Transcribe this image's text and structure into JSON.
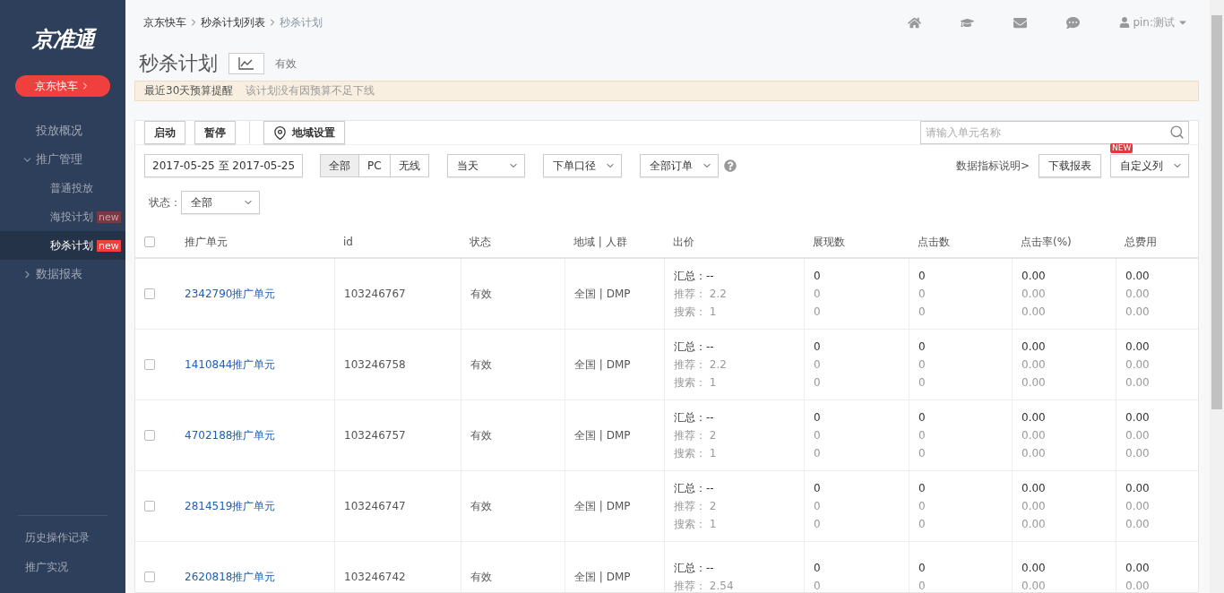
{
  "logo": "京准通",
  "sidebar": {
    "cta": "京东快车",
    "items": [
      {
        "label": "投放概况",
        "kind": "link",
        "selected": false
      },
      {
        "label": "推广管理",
        "kind": "group",
        "expanded": true,
        "selected": false,
        "children": [
          {
            "label": "普通投放",
            "selected": false
          },
          {
            "label": "海投计划",
            "selected": false,
            "badge": "new"
          },
          {
            "label": "秒杀计划",
            "selected": true,
            "badge": "new"
          }
        ]
      },
      {
        "label": "数据报表",
        "kind": "group",
        "expanded": false,
        "selected": false
      }
    ],
    "footer": [
      "历史操作记录",
      "推广实况"
    ]
  },
  "breadcrumb": [
    "京东快车",
    "秒杀计划列表",
    "秒杀计划"
  ],
  "user": "pin:测试",
  "title": "秒杀计划",
  "status": "有效",
  "notice": {
    "title": "最近30天预算提醒",
    "text": "该计划没有因预算不足下线"
  },
  "toolbar": {
    "buttons": [
      "启动",
      "暂停"
    ],
    "region_button": "地域设置",
    "search": {
      "placeholder": "请输入单元名称"
    }
  },
  "filters": {
    "date": "2017-05-25 至 2017-05-25",
    "devices": [
      {
        "label": "全部",
        "selected": true
      },
      {
        "label": "PC",
        "selected": false
      },
      {
        "label": "无线",
        "selected": false
      }
    ],
    "selects": [
      "当天",
      "下单口径",
      "全部订单"
    ],
    "metrics_link": "数据指标说明>",
    "download": "下载报表",
    "columns_select": "自定义列",
    "columns_badge": "NEW",
    "status_label": "状态：",
    "status_select": "全部"
  },
  "table": {
    "header_checked": false,
    "columns": [
      "推广单元",
      "id",
      "状态",
      "地域 | 人群",
      "出价",
      "展现数",
      "点击数",
      "点击率(%)",
      "总费用"
    ],
    "rows": [
      {
        "checked": false,
        "unit": "2342790推广单元",
        "id": "103246767",
        "status": "有效",
        "region": "全国 | DMP",
        "bid": [
          "汇总：--",
          "推荐： 2.2",
          "搜索： 1"
        ],
        "impressions": [
          "0",
          "0",
          "0"
        ],
        "clicks": [
          "0",
          "0",
          "0"
        ],
        "ctr": [
          "0.00",
          "0.00",
          "0.00"
        ],
        "cost": [
          "0.00",
          "0.00",
          "0.00"
        ]
      },
      {
        "checked": false,
        "unit": "1410844推广单元",
        "id": "103246758",
        "status": "有效",
        "region": "全国 | DMP",
        "bid": [
          "汇总：--",
          "推荐： 2.2",
          "搜索： 1"
        ],
        "impressions": [
          "0",
          "0",
          "0"
        ],
        "clicks": [
          "0",
          "0",
          "0"
        ],
        "ctr": [
          "0.00",
          "0.00",
          "0.00"
        ],
        "cost": [
          "0.00",
          "0.00",
          "0.00"
        ]
      },
      {
        "checked": false,
        "unit": "4702188推广单元",
        "id": "103246757",
        "status": "有效",
        "region": "全国 | DMP",
        "bid": [
          "汇总：--",
          "推荐： 2",
          "搜索： 1"
        ],
        "impressions": [
          "0",
          "0",
          "0"
        ],
        "clicks": [
          "0",
          "0",
          "0"
        ],
        "ctr": [
          "0.00",
          "0.00",
          "0.00"
        ],
        "cost": [
          "0.00",
          "0.00",
          "0.00"
        ]
      },
      {
        "checked": false,
        "unit": "2814519推广单元",
        "id": "103246747",
        "status": "有效",
        "region": "全国 | DMP",
        "bid": [
          "汇总：--",
          "推荐： 2",
          "搜索： 1"
        ],
        "impressions": [
          "0",
          "0",
          "0"
        ],
        "clicks": [
          "0",
          "0",
          "0"
        ],
        "ctr": [
          "0.00",
          "0.00",
          "0.00"
        ],
        "cost": [
          "0.00",
          "0.00",
          "0.00"
        ]
      },
      {
        "checked": false,
        "unit": "2620818推广单元",
        "id": "103246742",
        "status": "有效",
        "region": "全国 | DMP",
        "bid": [
          "汇总：--",
          "推荐： 2.54"
        ],
        "impressions": [
          "0",
          "0"
        ],
        "clicks": [
          "0",
          "0"
        ],
        "ctr": [
          "0.00",
          "0.00"
        ],
        "cost": [
          "0.00",
          "0.00"
        ]
      }
    ]
  }
}
